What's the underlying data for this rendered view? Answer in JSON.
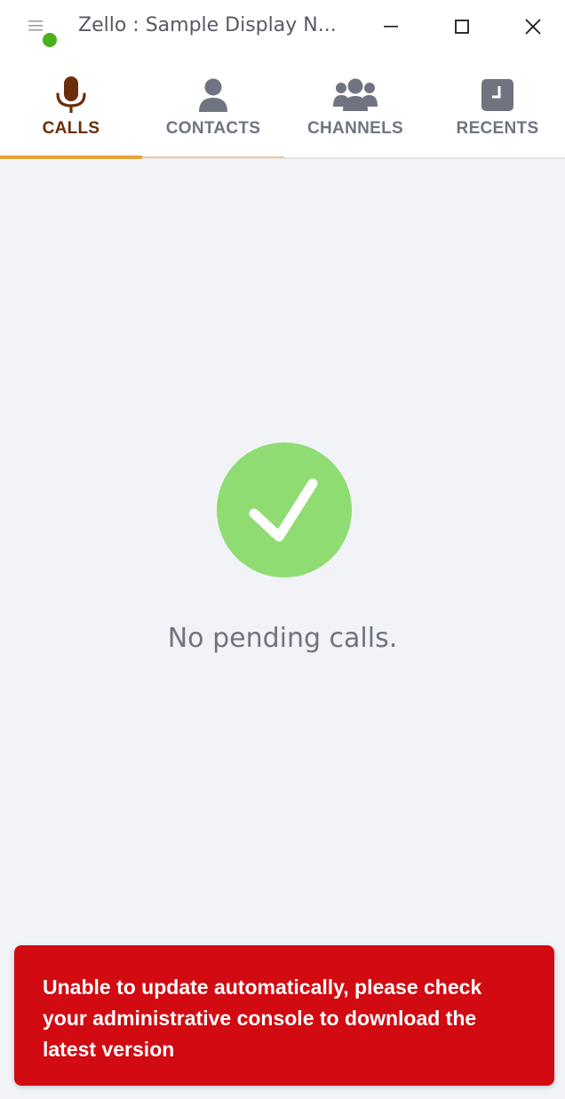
{
  "window": {
    "title": "Zello : Sample Display N...",
    "status_color": "#4caf1e",
    "menu_icon": "hamburger-icon",
    "minimize_icon": "minimize-icon",
    "maximize_icon": "maximize-icon",
    "close_icon": "close-icon"
  },
  "tabs": [
    {
      "label": "CALLS",
      "icon": "microphone-icon",
      "active": true
    },
    {
      "label": "CONTACTS",
      "icon": "person-icon",
      "active": false
    },
    {
      "label": "CHANNELS",
      "icon": "group-icon",
      "active": false
    },
    {
      "label": "RECENTS",
      "icon": "clock-icon",
      "active": false
    }
  ],
  "colors": {
    "accent": "#e3a53a",
    "active_tab_text": "#6b2e0a",
    "inactive_tab": "#6f7480",
    "success": "#8fdc72",
    "error": "#d20a11",
    "background": "#f2f3f7"
  },
  "main": {
    "status_icon": "checkmark-circle-icon",
    "empty_message": "No pending calls."
  },
  "toast": {
    "message": "Unable to update automatically, please check your administrative console to download the latest version"
  }
}
